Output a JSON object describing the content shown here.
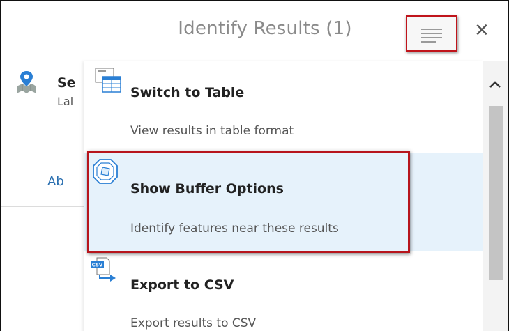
{
  "panel": {
    "title": "Identify Results (1)",
    "close_label": "✕"
  },
  "background_result": {
    "title_partial": "Se",
    "subtitle_partial": "Lal",
    "link_partial": "Ab"
  },
  "menu": {
    "items": [
      {
        "title": "Switch to Table",
        "description": "View results in table format",
        "icon": "table-icon"
      },
      {
        "title": "Show Buffer Options",
        "description": "Identify features near these results",
        "icon": "buffer-icon"
      },
      {
        "title": "Export to CSV",
        "description": "Export results to CSV",
        "icon": "csv-export-icon"
      }
    ]
  },
  "scrollbar": {
    "up_arrow": "^"
  },
  "colors": {
    "annotation_red": "#c0141b",
    "hover_blue": "#e6f2fb",
    "icon_blue": "#2a7fd4"
  }
}
